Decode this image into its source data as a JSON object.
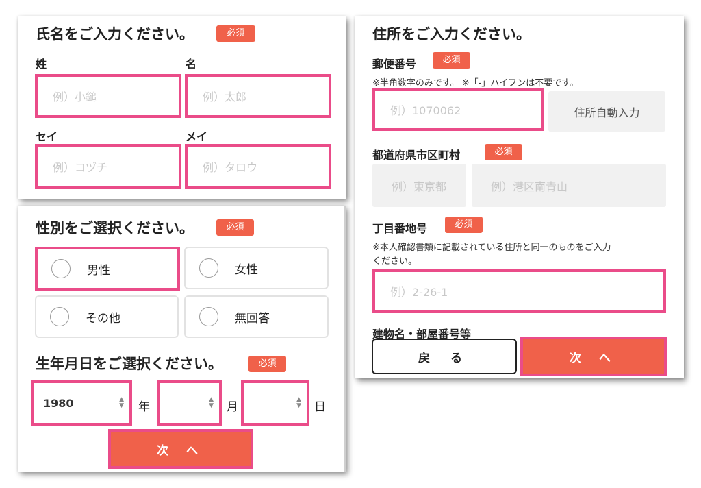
{
  "required_badge": "必須",
  "name_section": {
    "title": "氏名をご入力ください。",
    "last_name_label": "姓",
    "first_name_label": "名",
    "last_name_placeholder": "例）小鎚",
    "first_name_placeholder": "例）太郎",
    "last_kana_label": "セイ",
    "first_kana_label": "メイ",
    "last_kana_placeholder": "例）コヅチ",
    "first_kana_placeholder": "例）タロウ"
  },
  "gender_section": {
    "title": "性別をご選択ください。",
    "options": [
      "男性",
      "女性",
      "その他",
      "無回答"
    ],
    "selected": ""
  },
  "birthday_section": {
    "title": "生年月日をご選択ください。",
    "year_value": "1980",
    "year_unit": "年",
    "month_value": "",
    "month_unit": "月",
    "day_value": "",
    "day_unit": "日",
    "next_label": "次 へ"
  },
  "address_section": {
    "title": "住所をご入力ください。",
    "postal_label": "郵便番号",
    "postal_note": "※半角数字のみです。 ※「-」ハイフンは不要です。",
    "postal_placeholder": "例）1070062",
    "auto_fill_label": "住所自動入力",
    "prefecture_city_label": "都道府県市区町村",
    "prefecture_placeholder": "例）東京都",
    "city_placeholder": "例）港区南青山",
    "street_label": "丁目番地号",
    "street_note_line1": "※本人確認書類に記載されている住所と同一のものをご入力",
    "street_note_line2": "ください。",
    "street_placeholder": "例）2-26-1",
    "building_label": "建物名・部屋番号等",
    "back_label": "戻 る",
    "next_label": "次 へ"
  },
  "colors": {
    "accent": "#f0614a",
    "highlight": "#ea4c89"
  }
}
